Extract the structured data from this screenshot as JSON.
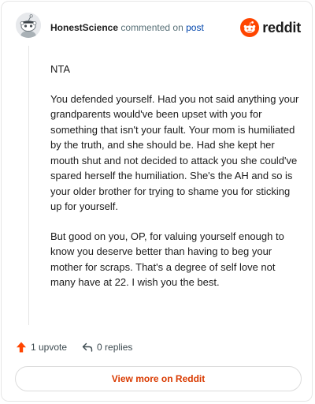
{
  "comment": {
    "username": "HonestScience",
    "action_text": "commented on",
    "target_link": "post",
    "paragraphs": [
      "NTA",
      "You defended yourself. Had you not said anything your grandparents would've been upset with you for something that isn't your fault. Your mom is humiliated by the truth, and she should be. Had she kept her mouth shut and not decided to attack you she could've spared herself the humiliation. She's the AH and so is your older brother for trying to shame you for sticking up for yourself.",
      "But good on you, OP, for valuing yourself enough to know you deserve better than having to beg your mother for scraps. That's a degree of self love not many have at 22. I wish you the best."
    ]
  },
  "brand": {
    "name": "reddit",
    "icon": "reddit-logo-icon",
    "color": "#ff4500"
  },
  "actions": {
    "upvote_label": "1 upvote",
    "upvote_icon": "upvote-arrow-icon",
    "replies_label": "0 replies",
    "replies_icon": "reply-arrow-icon"
  },
  "cta": {
    "label": "View more on Reddit",
    "color": "#d93a00"
  }
}
